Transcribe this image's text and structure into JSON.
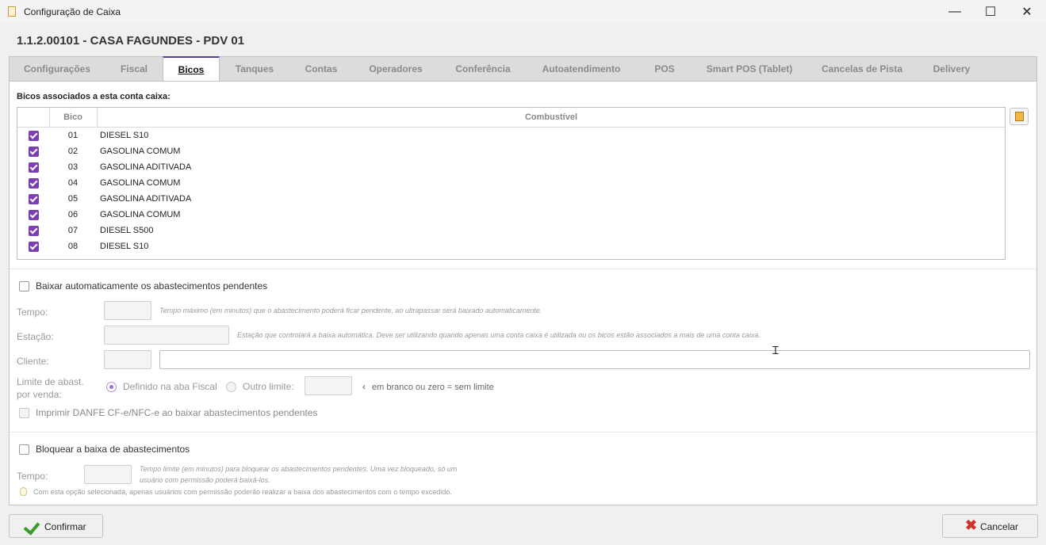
{
  "window": {
    "title": "Configuração de Caixa",
    "minimize": "—",
    "maximize": "☐",
    "close": "✕"
  },
  "header": {
    "title": "1.1.2.00101 - CASA FAGUNDES - PDV 01"
  },
  "tabs": [
    {
      "label": "Configurações"
    },
    {
      "label": "Fiscal"
    },
    {
      "label": "Bicos"
    },
    {
      "label": "Tanques"
    },
    {
      "label": "Contas"
    },
    {
      "label": "Operadores"
    },
    {
      "label": "Conferência"
    },
    {
      "label": "Autoatendimento"
    },
    {
      "label": "POS"
    },
    {
      "label": "Smart POS (Tablet)"
    },
    {
      "label": "Cancelas de Pista"
    },
    {
      "label": "Delivery"
    }
  ],
  "active_tab": "Bicos",
  "bicos": {
    "section_label": "Bicos associados a esta conta caixa:",
    "columns": [
      "Bico",
      "Combustível"
    ],
    "rows": [
      {
        "checked": true,
        "bico": "01",
        "combustivel": "DIESEL S10"
      },
      {
        "checked": true,
        "bico": "02",
        "combustivel": "GASOLINA COMUM"
      },
      {
        "checked": true,
        "bico": "03",
        "combustivel": "GASOLINA ADITIVADA"
      },
      {
        "checked": true,
        "bico": "04",
        "combustivel": "GASOLINA COMUM"
      },
      {
        "checked": true,
        "bico": "05",
        "combustivel": "GASOLINA ADITIVADA"
      },
      {
        "checked": true,
        "bico": "06",
        "combustivel": "GASOLINA COMUM"
      },
      {
        "checked": true,
        "bico": "07",
        "combustivel": "DIESEL S500"
      },
      {
        "checked": true,
        "bico": "08",
        "combustivel": "DIESEL S10"
      }
    ]
  },
  "baixa_auto": {
    "checkbox_label": "Baixar automaticamente os abastecimentos pendentes",
    "checked": false,
    "tempo_label": "Tempo:",
    "tempo_value": "",
    "tempo_hint": "Tempo máximo (em minutos) que o abastecimento poderá ficar pendente, ao ultrapassar será baixado automaticamente.",
    "estacao_label": "Estação:",
    "estacao_value": "",
    "estacao_hint": "Estação que controlará a baixa automática. Deve ser utilizando quando apenas uma conta caixa é utilizada ou os bicos estão associados a mais de uma conta caixa.",
    "cliente_label": "Cliente:",
    "cliente_code": "",
    "cliente_name": "",
    "limite_label_1": "Limite de abast.",
    "limite_label_2": "por venda:",
    "radio_fiscal": "Definido na aba Fiscal",
    "radio_outro": "Outro limite:",
    "limite_value": "",
    "limite_hint": "em branco ou zero = sem limite",
    "imprimir_label": "Imprimir DANFE CF-e/NFC-e ao baixar abastecimentos pendentes"
  },
  "bloquear": {
    "checkbox_label": "Bloquear a baixa de abastecimentos",
    "checked": false,
    "tempo_label": "Tempo:",
    "tempo_value": "",
    "tempo_hint_1": "Tempo limite (em minutos) para bloquear os abastecimentos pendentes. Uma vez bloqueado, só um",
    "tempo_hint_2": "usuário com permissão poderá baixá-los.",
    "info": "Com esta opção selecionada, apenas usuários com permissão poderão realizar a baixa dos abastecimentos com o tempo excedido."
  },
  "footer": {
    "confirm_label": "Confirmar",
    "cancel_label": "Cancelar"
  },
  "colors": {
    "accent": "#7b3fb3",
    "cancel_icon": "#d0302a",
    "confirm_icon": "#3a9a2a"
  }
}
